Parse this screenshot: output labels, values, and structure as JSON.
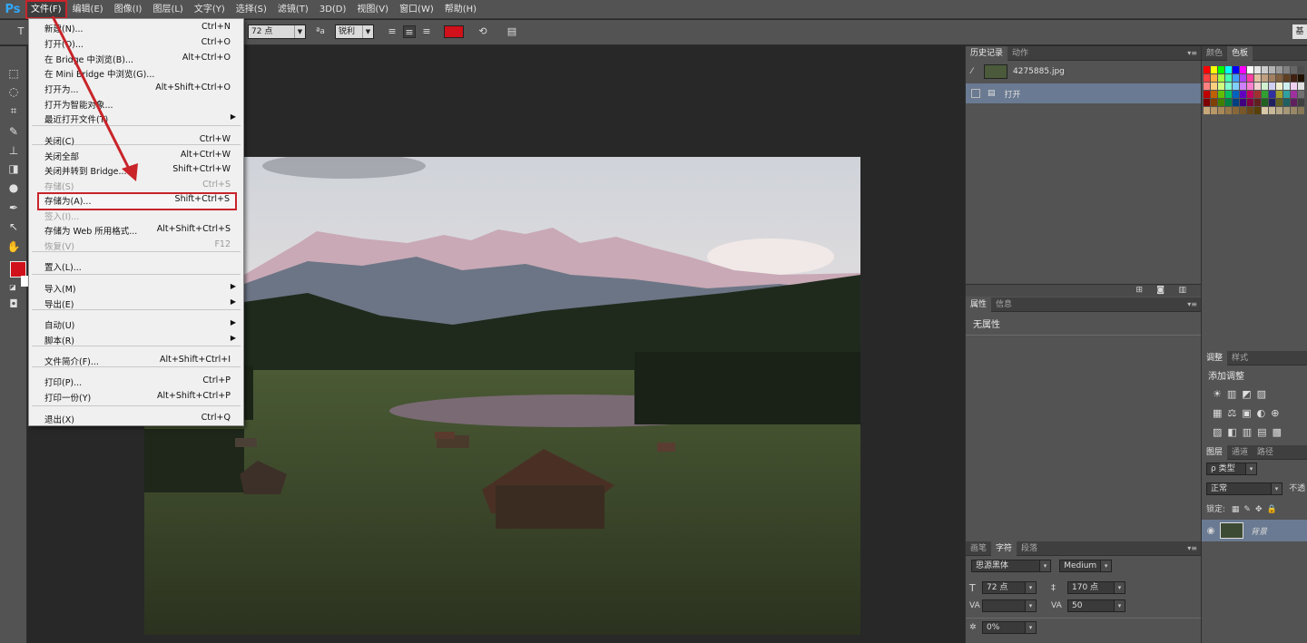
{
  "menubar": {
    "logo": "Ps",
    "items": [
      "文件(F)",
      "编辑(E)",
      "图像(I)",
      "图层(L)",
      "文字(Y)",
      "选择(S)",
      "滤镜(T)",
      "3D(D)",
      "视图(V)",
      "窗口(W)",
      "帮助(H)"
    ]
  },
  "options": {
    "font_size": "72 点",
    "aa_icon": "ªa",
    "antialias": "锐利",
    "text_color": "#d0101a",
    "right_btn": "基"
  },
  "file_menu": {
    "items": [
      {
        "label": "新建(N)...",
        "shortcut": "Ctrl+N"
      },
      {
        "label": "打开(O)...",
        "shortcut": "Ctrl+O"
      },
      {
        "label": "在 Bridge 中浏览(B)...",
        "shortcut": "Alt+Ctrl+O"
      },
      {
        "label": "在 Mini Bridge 中浏览(G)...",
        "shortcut": ""
      },
      {
        "label": "打开为...",
        "shortcut": "Alt+Shift+Ctrl+O"
      },
      {
        "label": "打开为智能对象...",
        "shortcut": ""
      },
      {
        "label": "最近打开文件(T)",
        "shortcut": ""
      },
      {
        "label": "关闭(C)",
        "shortcut": "Ctrl+W"
      },
      {
        "label": "关闭全部",
        "shortcut": "Alt+Ctrl+W"
      },
      {
        "label": "关闭并转到 Bridge...",
        "shortcut": "Shift+Ctrl+W"
      },
      {
        "label": "存储(S)",
        "shortcut": "Ctrl+S"
      },
      {
        "label": "存储为(A)...",
        "shortcut": "Shift+Ctrl+S"
      },
      {
        "label": "签入(I)...",
        "shortcut": ""
      },
      {
        "label": "存储为 Web 所用格式...",
        "shortcut": "Alt+Shift+Ctrl+S"
      },
      {
        "label": "恢复(V)",
        "shortcut": "F12"
      },
      {
        "label": "置入(L)...",
        "shortcut": ""
      },
      {
        "label": "导入(M)",
        "shortcut": ""
      },
      {
        "label": "导出(E)",
        "shortcut": ""
      },
      {
        "label": "自动(U)",
        "shortcut": ""
      },
      {
        "label": "脚本(R)",
        "shortcut": ""
      },
      {
        "label": "文件简介(F)...",
        "shortcut": "Alt+Shift+Ctrl+I"
      },
      {
        "label": "打印(P)...",
        "shortcut": "Ctrl+P"
      },
      {
        "label": "打印一份(Y)",
        "shortcut": "Alt+Shift+Ctrl+P"
      },
      {
        "label": "退出(X)",
        "shortcut": "Ctrl+Q"
      }
    ]
  },
  "history_panel": {
    "tabs": [
      "历史记录",
      "动作"
    ],
    "snapshot": "4275885.jpg",
    "step": "打开"
  },
  "properties_panel": {
    "tabs": [
      "属性",
      "信息"
    ],
    "empty_text": "无属性"
  },
  "character_panel": {
    "tabs": [
      "画笔",
      "字符",
      "段落"
    ],
    "font_family": "思源黑体",
    "font_style": "Medium",
    "size": "72 点",
    "leading": "170 点",
    "tracking": "50",
    "scale": "0%"
  },
  "swatches_panel": {
    "tabs": [
      "颜色",
      "色板"
    ]
  },
  "adjustments_panel": {
    "tabs": [
      "调整",
      "样式"
    ],
    "title": "添加调整"
  },
  "layers_panel": {
    "tabs": [
      "图层",
      "通道",
      "路径"
    ],
    "filter": "类型",
    "blend": "正常",
    "opacity_label": "不透",
    "lock_label": "锁定:",
    "layer_name": "背景"
  }
}
